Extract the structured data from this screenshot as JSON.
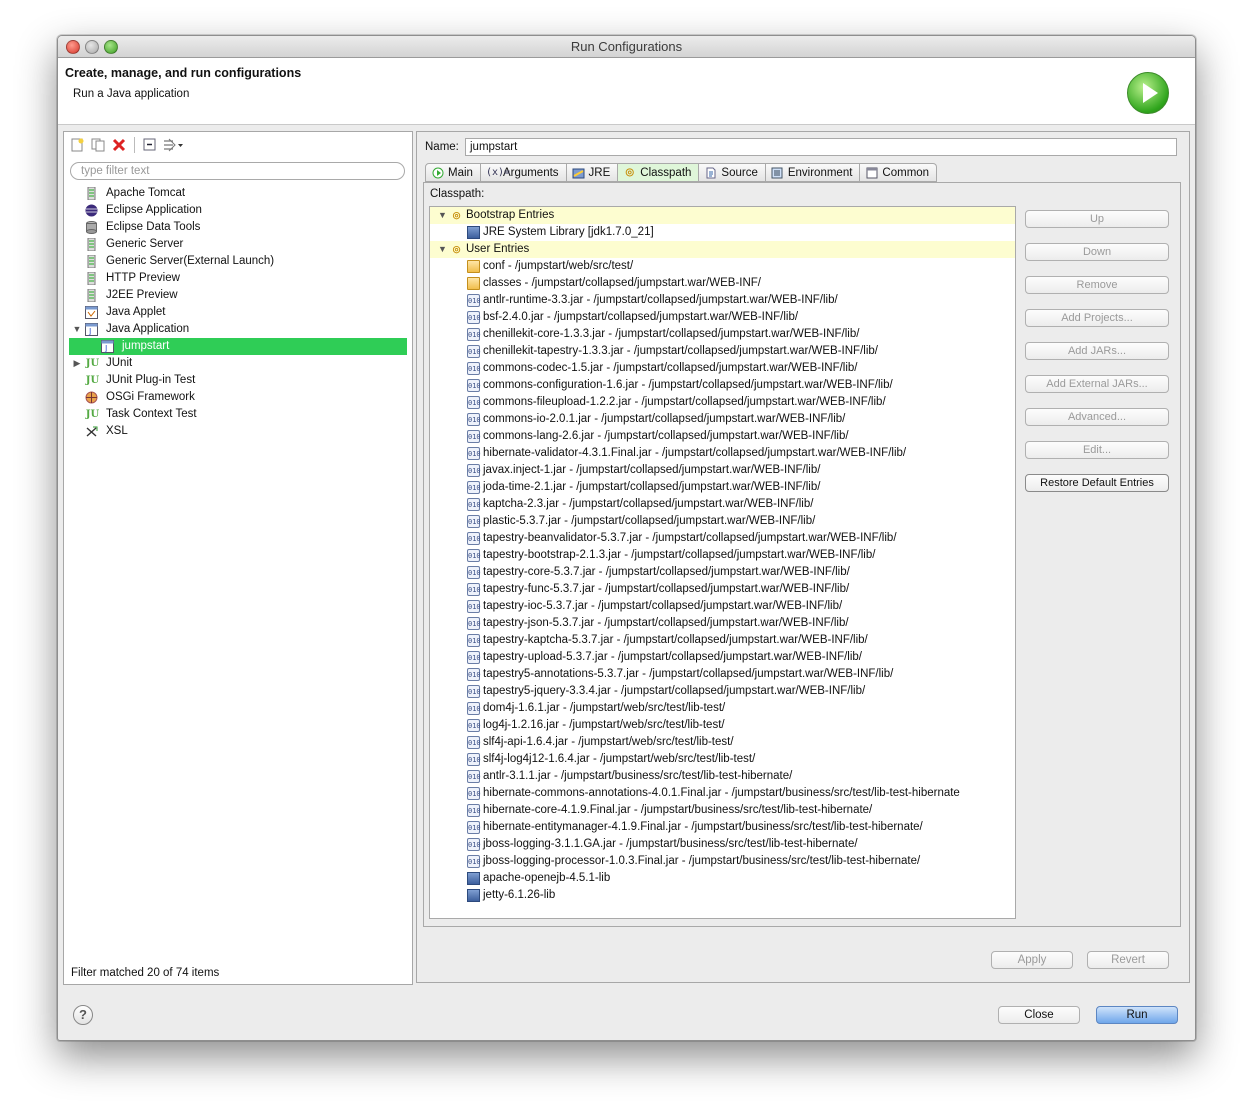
{
  "window": {
    "title": "Run Configurations"
  },
  "banner": {
    "title": "Create, manage, and run configurations",
    "subtitle": "Run a Java application"
  },
  "left": {
    "filter_placeholder": "type filter text",
    "tree": [
      {
        "label": "Apache Tomcat",
        "icon": "server-icon",
        "level": 1
      },
      {
        "label": "Eclipse Application",
        "icon": "eclipse-icon",
        "level": 1
      },
      {
        "label": "Eclipse Data Tools",
        "icon": "database-icon",
        "level": 1
      },
      {
        "label": "Generic Server",
        "icon": "server-icon",
        "level": 1
      },
      {
        "label": "Generic Server(External Launch)",
        "icon": "server-icon",
        "level": 1
      },
      {
        "label": "HTTP Preview",
        "icon": "server-icon",
        "level": 1
      },
      {
        "label": "J2EE Preview",
        "icon": "server-icon",
        "level": 1
      },
      {
        "label": "Java Applet",
        "icon": "applet-icon",
        "level": 1
      },
      {
        "label": "Java Application",
        "icon": "java-app-icon",
        "level": 1,
        "expanded": true
      },
      {
        "label": "jumpstart",
        "icon": "java-app-icon",
        "level": 2,
        "selected": true
      },
      {
        "label": "JUnit",
        "icon": "junit-icon",
        "level": 1,
        "collapsed": true
      },
      {
        "label": "JUnit Plug-in Test",
        "icon": "junit-plugin-icon",
        "level": 1
      },
      {
        "label": "OSGi Framework",
        "icon": "osgi-icon",
        "level": 1
      },
      {
        "label": "Task Context Test",
        "icon": "junit-icon",
        "level": 1
      },
      {
        "label": "XSL",
        "icon": "xsl-icon",
        "level": 1
      }
    ],
    "status": "Filter matched 20 of 74 items"
  },
  "right": {
    "name_label": "Name:",
    "name_value": "jumpstart",
    "tabs": [
      {
        "label": "Main",
        "icon": "main-tab-icon"
      },
      {
        "label": "Arguments",
        "icon": "arguments-tab-icon"
      },
      {
        "label": "JRE",
        "icon": "jre-tab-icon"
      },
      {
        "label": "Classpath",
        "icon": "classpath-tab-icon",
        "active": true
      },
      {
        "label": "Source",
        "icon": "source-tab-icon"
      },
      {
        "label": "Environment",
        "icon": "environment-tab-icon"
      },
      {
        "label": "Common",
        "icon": "common-tab-icon"
      }
    ],
    "classpath_label": "Classpath:",
    "classpath": [
      {
        "label": "Bootstrap Entries",
        "type": "header"
      },
      {
        "label": "JRE System Library [jdk1.7.0_21]",
        "type": "lib",
        "level": 2
      },
      {
        "label": "User Entries",
        "type": "header"
      },
      {
        "label": "conf - /jumpstart/web/src/test/",
        "type": "folder"
      },
      {
        "label": "classes - /jumpstart/collapsed/jumpstart.war/WEB-INF/",
        "type": "folder"
      },
      {
        "label": "antlr-runtime-3.3.jar - /jumpstart/collapsed/jumpstart.war/WEB-INF/lib/",
        "type": "jar"
      },
      {
        "label": "bsf-2.4.0.jar - /jumpstart/collapsed/jumpstart.war/WEB-INF/lib/",
        "type": "jar"
      },
      {
        "label": "chenillekit-core-1.3.3.jar - /jumpstart/collapsed/jumpstart.war/WEB-INF/lib/",
        "type": "jar"
      },
      {
        "label": "chenillekit-tapestry-1.3.3.jar - /jumpstart/collapsed/jumpstart.war/WEB-INF/lib/",
        "type": "jar"
      },
      {
        "label": "commons-codec-1.5.jar - /jumpstart/collapsed/jumpstart.war/WEB-INF/lib/",
        "type": "jar"
      },
      {
        "label": "commons-configuration-1.6.jar - /jumpstart/collapsed/jumpstart.war/WEB-INF/lib/",
        "type": "jar"
      },
      {
        "label": "commons-fileupload-1.2.2.jar - /jumpstart/collapsed/jumpstart.war/WEB-INF/lib/",
        "type": "jar"
      },
      {
        "label": "commons-io-2.0.1.jar - /jumpstart/collapsed/jumpstart.war/WEB-INF/lib/",
        "type": "jar"
      },
      {
        "label": "commons-lang-2.6.jar - /jumpstart/collapsed/jumpstart.war/WEB-INF/lib/",
        "type": "jar"
      },
      {
        "label": "hibernate-validator-4.3.1.Final.jar - /jumpstart/collapsed/jumpstart.war/WEB-INF/lib/",
        "type": "jar"
      },
      {
        "label": "javax.inject-1.jar - /jumpstart/collapsed/jumpstart.war/WEB-INF/lib/",
        "type": "jar"
      },
      {
        "label": "joda-time-2.1.jar - /jumpstart/collapsed/jumpstart.war/WEB-INF/lib/",
        "type": "jar"
      },
      {
        "label": "kaptcha-2.3.jar - /jumpstart/collapsed/jumpstart.war/WEB-INF/lib/",
        "type": "jar"
      },
      {
        "label": "plastic-5.3.7.jar - /jumpstart/collapsed/jumpstart.war/WEB-INF/lib/",
        "type": "jar"
      },
      {
        "label": "tapestry-beanvalidator-5.3.7.jar - /jumpstart/collapsed/jumpstart.war/WEB-INF/lib/",
        "type": "jar"
      },
      {
        "label": "tapestry-bootstrap-2.1.3.jar - /jumpstart/collapsed/jumpstart.war/WEB-INF/lib/",
        "type": "jar"
      },
      {
        "label": "tapestry-core-5.3.7.jar - /jumpstart/collapsed/jumpstart.war/WEB-INF/lib/",
        "type": "jar"
      },
      {
        "label": "tapestry-func-5.3.7.jar - /jumpstart/collapsed/jumpstart.war/WEB-INF/lib/",
        "type": "jar"
      },
      {
        "label": "tapestry-ioc-5.3.7.jar - /jumpstart/collapsed/jumpstart.war/WEB-INF/lib/",
        "type": "jar"
      },
      {
        "label": "tapestry-json-5.3.7.jar - /jumpstart/collapsed/jumpstart.war/WEB-INF/lib/",
        "type": "jar"
      },
      {
        "label": "tapestry-kaptcha-5.3.7.jar - /jumpstart/collapsed/jumpstart.war/WEB-INF/lib/",
        "type": "jar"
      },
      {
        "label": "tapestry-upload-5.3.7.jar - /jumpstart/collapsed/jumpstart.war/WEB-INF/lib/",
        "type": "jar"
      },
      {
        "label": "tapestry5-annotations-5.3.7.jar - /jumpstart/collapsed/jumpstart.war/WEB-INF/lib/",
        "type": "jar"
      },
      {
        "label": "tapestry5-jquery-3.3.4.jar - /jumpstart/collapsed/jumpstart.war/WEB-INF/lib/",
        "type": "jar"
      },
      {
        "label": "dom4j-1.6.1.jar - /jumpstart/web/src/test/lib-test/",
        "type": "jar"
      },
      {
        "label": "log4j-1.2.16.jar - /jumpstart/web/src/test/lib-test/",
        "type": "jar"
      },
      {
        "label": "slf4j-api-1.6.4.jar - /jumpstart/web/src/test/lib-test/",
        "type": "jar"
      },
      {
        "label": "slf4j-log4j12-1.6.4.jar - /jumpstart/web/src/test/lib-test/",
        "type": "jar"
      },
      {
        "label": "antlr-3.1.1.jar - /jumpstart/business/src/test/lib-test-hibernate/",
        "type": "jar"
      },
      {
        "label": "hibernate-commons-annotations-4.0.1.Final.jar - /jumpstart/business/src/test/lib-test-hibernate",
        "type": "jar"
      },
      {
        "label": "hibernate-core-4.1.9.Final.jar - /jumpstart/business/src/test/lib-test-hibernate/",
        "type": "jar"
      },
      {
        "label": "hibernate-entitymanager-4.1.9.Final.jar - /jumpstart/business/src/test/lib-test-hibernate/",
        "type": "jar"
      },
      {
        "label": "jboss-logging-3.1.1.GA.jar - /jumpstart/business/src/test/lib-test-hibernate/",
        "type": "jar"
      },
      {
        "label": "jboss-logging-processor-1.0.3.Final.jar - /jumpstart/business/src/test/lib-test-hibernate/",
        "type": "jar"
      },
      {
        "label": "apache-openejb-4.5.1-lib",
        "type": "lib"
      },
      {
        "label": "jetty-6.1.26-lib",
        "type": "lib"
      }
    ],
    "side_buttons": [
      {
        "label": "Up",
        "enabled": false
      },
      {
        "label": "Down",
        "enabled": false
      },
      {
        "label": "Remove",
        "enabled": false
      },
      {
        "label": "Add Projects...",
        "enabled": false
      },
      {
        "label": "Add JARs...",
        "enabled": false
      },
      {
        "label": "Add External JARs...",
        "enabled": false
      },
      {
        "label": "Advanced...",
        "enabled": false
      },
      {
        "label": "Edit...",
        "enabled": false
      },
      {
        "label": "Restore Default Entries",
        "enabled": true
      }
    ],
    "apply_label": "Apply",
    "revert_label": "Revert"
  },
  "footer": {
    "close_label": "Close",
    "run_label": "Run",
    "help_glyph": "?"
  }
}
